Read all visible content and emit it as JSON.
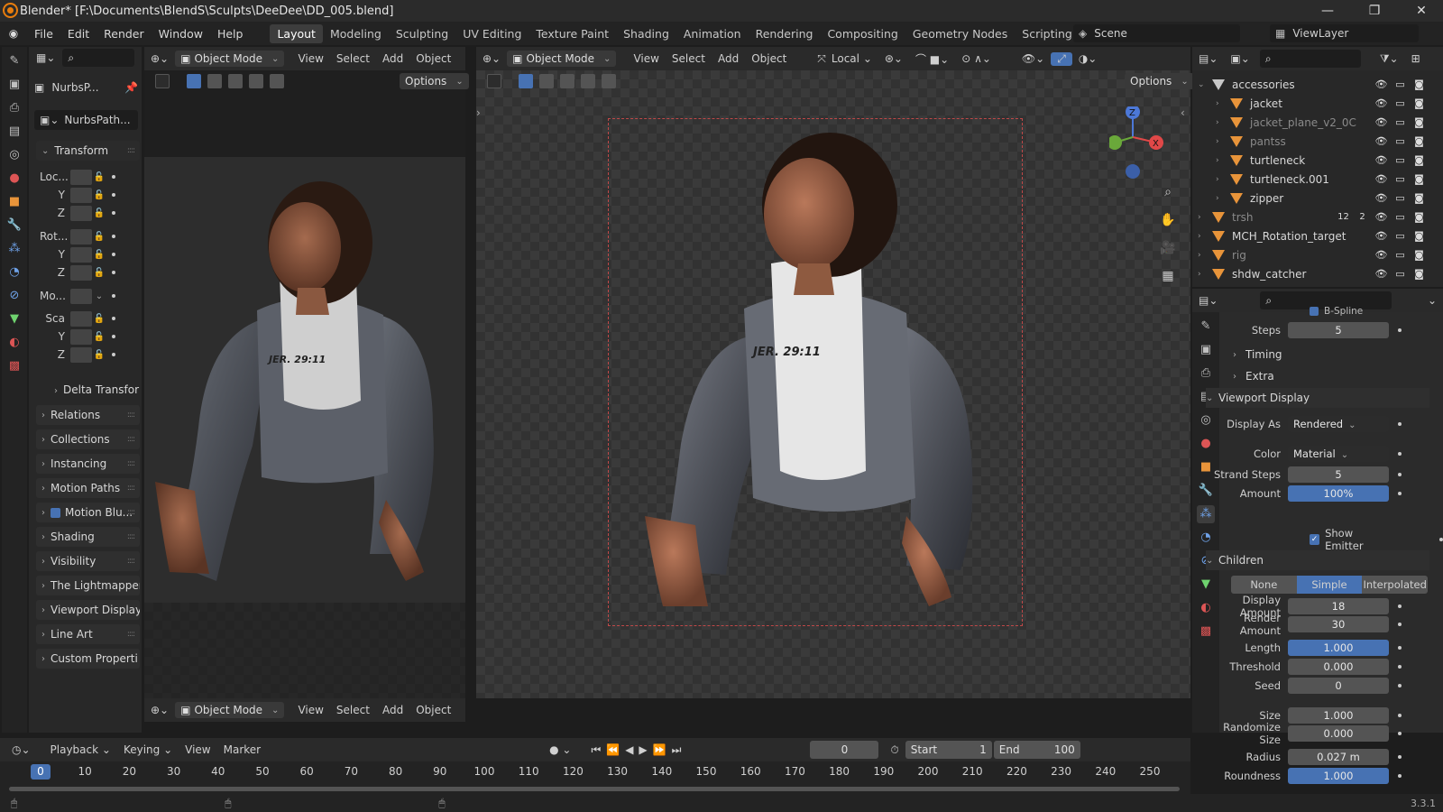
{
  "title": "Blender* [F:\\Documents\\BlendS\\Sculpts\\DeeDee\\DD_005.blend]",
  "menu": [
    "File",
    "Edit",
    "Render",
    "Window",
    "Help"
  ],
  "workspaces": [
    "Layout",
    "Modeling",
    "Sculpting",
    "UV Editing",
    "Texture Paint",
    "Shading",
    "Animation",
    "Rendering",
    "Compositing",
    "Geometry Nodes",
    "Scripting"
  ],
  "scene": "Scene",
  "view_layer": "ViewLayer",
  "viewport": {
    "mode": "Object Mode",
    "menus": [
      "View",
      "Select",
      "Add",
      "Object"
    ],
    "options": "Options",
    "transform_orientation": "Local"
  },
  "npanel": {
    "object_name": "NurbsP...",
    "data_name": "NurbsPath...",
    "transform_label": "Transform",
    "loc": "Loc...",
    "rot": "Rot...",
    "mode": "Mo...",
    "scale": "Sca",
    "axes": [
      "Y",
      "Z"
    ],
    "sections": [
      "Relations",
      "Collections",
      "Instancing",
      "Motion Paths",
      "Motion Blu...",
      "Shading",
      "Visibility",
      "The Lightmapper",
      "Viewport Display",
      "Line Art",
      "Custom Properti"
    ],
    "delta": "Delta Transfor"
  },
  "outliner": {
    "rows": [
      {
        "name": "accessories",
        "depth": 0,
        "dim": false
      },
      {
        "name": "jacket",
        "depth": 1,
        "dim": false
      },
      {
        "name": "jacket_plane_v2_0C",
        "depth": 1,
        "dim": true
      },
      {
        "name": "pantss",
        "depth": 1,
        "dim": true
      },
      {
        "name": "turtleneck",
        "depth": 1,
        "dim": false
      },
      {
        "name": "turtleneck.001",
        "depth": 1,
        "dim": false
      },
      {
        "name": "zipper",
        "depth": 1,
        "dim": false
      },
      {
        "name": "trsh",
        "depth": 0,
        "dim": true
      },
      {
        "name": "MCH_Rotation_target",
        "depth": 0,
        "dim": false
      },
      {
        "name": "rig",
        "depth": 0,
        "dim": true
      },
      {
        "name": "shdw_catcher",
        "depth": 0,
        "dim": false
      }
    ],
    "trsh_counts": [
      "12",
      "2"
    ]
  },
  "properties": {
    "b_spline": "B-Spline",
    "steps_label": "Steps",
    "steps": "5",
    "timing": "Timing",
    "extra": "Extra",
    "viewport_display": "Viewport Display",
    "display_as_label": "Display As",
    "display_as": "Rendered",
    "color_label": "Color",
    "color": "Material",
    "strand_steps_label": "Strand Steps",
    "strand_steps": "5",
    "amount_label": "Amount",
    "amount": "100%",
    "show_emitter": "Show Emitter",
    "children": "Children",
    "child_none": "None",
    "child_simple": "Simple",
    "child_interp": "Interpolated",
    "display_amount_label": "Display Amount",
    "display_amount": "18",
    "render_amount_label": "Render Amount",
    "render_amount": "30",
    "length_label": "Length",
    "length": "1.000",
    "threshold_label": "Threshold",
    "threshold": "0.000",
    "seed_label": "Seed",
    "seed": "0",
    "size_label": "Size",
    "size": "1.000",
    "rand_size_label": "Randomize Size",
    "rand_size": "0.000",
    "radius_label": "Radius",
    "radius": "0.027 m",
    "roundness_label": "Roundness",
    "roundness": "1.000"
  },
  "timeline": {
    "playback": "Playback",
    "keying": "Keying",
    "view": "View",
    "marker": "Marker",
    "current": "0",
    "start_label": "Start",
    "start": "1",
    "end_label": "End",
    "end": "100",
    "ticks": [
      "0",
      "10",
      "20",
      "30",
      "40",
      "50",
      "60",
      "70",
      "80",
      "90",
      "100",
      "110",
      "120",
      "130",
      "140",
      "150",
      "160",
      "170",
      "180",
      "190",
      "200",
      "210",
      "220",
      "230",
      "240",
      "250"
    ]
  },
  "version": "3.3.1",
  "colors": {
    "accent": "#4772b3",
    "orange": "#e8943a",
    "bg": "#1d1d1d"
  }
}
